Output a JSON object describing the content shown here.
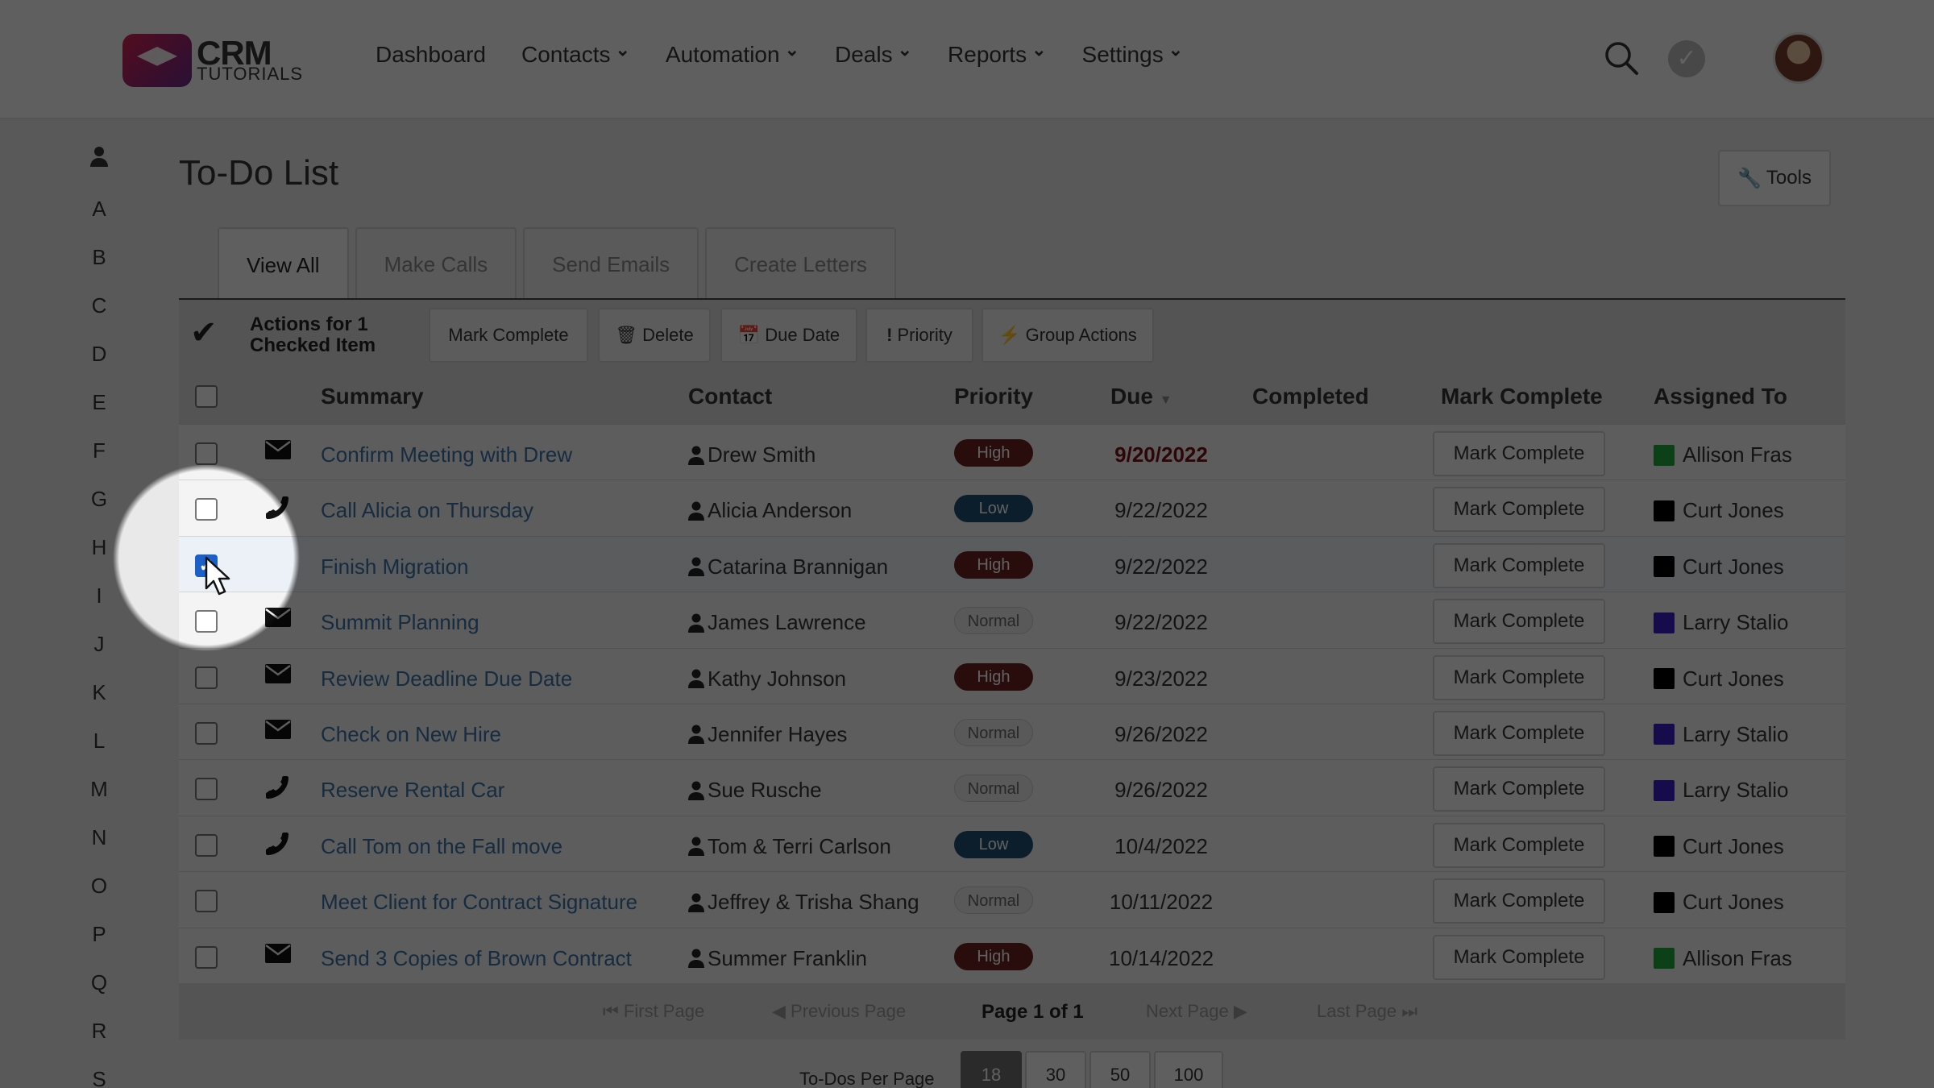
{
  "logo": {
    "line1": "CRM",
    "line2": "TUTORIALS"
  },
  "nav": [
    {
      "label": "Dashboard",
      "dropdown": false
    },
    {
      "label": "Contacts",
      "dropdown": true
    },
    {
      "label": "Automation",
      "dropdown": true
    },
    {
      "label": "Deals",
      "dropdown": true
    },
    {
      "label": "Reports",
      "dropdown": true
    },
    {
      "label": "Settings",
      "dropdown": true
    }
  ],
  "alpha": [
    "A",
    "B",
    "C",
    "D",
    "E",
    "F",
    "G",
    "H",
    "I",
    "J",
    "K",
    "L",
    "M",
    "N",
    "O",
    "P",
    "Q",
    "R",
    "S"
  ],
  "page": {
    "title": "To-Do List",
    "tools_label": "Tools"
  },
  "tabs": [
    "View All",
    "Make Calls",
    "Send Emails",
    "Create Letters"
  ],
  "actions": {
    "label_line1": "Actions for 1",
    "label_line2": "Checked Item",
    "buttons": [
      "Mark Complete",
      "Delete",
      "Due Date",
      "Priority",
      "Group Actions"
    ]
  },
  "columns": {
    "summary": "Summary",
    "contact": "Contact",
    "priority": "Priority",
    "due": "Due",
    "completed": "Completed",
    "mark_complete": "Mark Complete",
    "assigned": "Assigned To"
  },
  "rows": [
    {
      "checked": false,
      "type": "email",
      "summary": "Confirm Meeting with Drew",
      "contact": "Drew Smith",
      "priority": "High",
      "due": "9/20/2022",
      "overdue": true,
      "action": "Mark Complete",
      "assigned": "Allison Fras",
      "color": "#1ea83a"
    },
    {
      "checked": false,
      "type": "phone",
      "summary": "Call Alicia on Thursday",
      "contact": "Alicia Anderson",
      "priority": "Low",
      "due": "9/22/2022",
      "overdue": false,
      "action": "Mark Complete",
      "assigned": "Curt Jones",
      "color": "#000000"
    },
    {
      "checked": true,
      "type": "none",
      "summary": "Finish Migration",
      "contact": "Catarina Brannigan",
      "priority": "High",
      "due": "9/22/2022",
      "overdue": false,
      "action": "Mark Complete",
      "assigned": "Curt Jones",
      "color": "#000000"
    },
    {
      "checked": false,
      "type": "email",
      "summary": "Summit Planning",
      "contact": "James Lawrence",
      "priority": "Normal",
      "due": "9/22/2022",
      "overdue": false,
      "action": "Mark Complete",
      "assigned": "Larry Stalio",
      "color": "#3a1fc4"
    },
    {
      "checked": false,
      "type": "email",
      "summary": "Review Deadline Due Date",
      "contact": "Kathy Johnson",
      "priority": "High",
      "due": "9/23/2022",
      "overdue": false,
      "action": "Mark Complete",
      "assigned": "Curt Jones",
      "color": "#000000"
    },
    {
      "checked": false,
      "type": "email",
      "summary": "Check on New Hire",
      "contact": "Jennifer Hayes",
      "priority": "Normal",
      "due": "9/26/2022",
      "overdue": false,
      "action": "Mark Complete",
      "assigned": "Larry Stalio",
      "color": "#3a1fc4"
    },
    {
      "checked": false,
      "type": "phone",
      "summary": "Reserve Rental Car",
      "contact": "Sue Rusche",
      "priority": "Normal",
      "due": "9/26/2022",
      "overdue": false,
      "action": "Mark Complete",
      "assigned": "Larry Stalio",
      "color": "#3a1fc4"
    },
    {
      "checked": false,
      "type": "phone",
      "summary": "Call Tom on the Fall move",
      "contact": "Tom & Terri Carlson",
      "priority": "Low",
      "due": "10/4/2022",
      "overdue": false,
      "action": "Mark Complete",
      "assigned": "Curt Jones",
      "color": "#000000"
    },
    {
      "checked": false,
      "type": "none",
      "summary": "Meet Client for Contract Signature",
      "contact": "Jeffrey & Trisha Shang",
      "priority": "Normal",
      "due": "10/11/2022",
      "overdue": false,
      "action": "Mark Complete",
      "assigned": "Curt Jones",
      "color": "#000000"
    },
    {
      "checked": false,
      "type": "email",
      "summary": "Send 3 Copies of Brown Contract",
      "contact": "Summer Franklin",
      "priority": "High",
      "due": "10/14/2022",
      "overdue": false,
      "action": "Mark Complete",
      "assigned": "Allison Fras",
      "color": "#1ea83a"
    }
  ],
  "pager": {
    "first": "First Page",
    "prev": "Previous Page",
    "current": "Page 1 of 1",
    "next": "Next Page",
    "last": "Last Page"
  },
  "per_page": {
    "label": "To-Dos Per Page",
    "options": [
      "18",
      "30",
      "50",
      "100"
    ],
    "selected": "18"
  },
  "colors": {
    "link": "#3a72a8",
    "high": "#6b2020",
    "low": "#1e4e74",
    "overdue": "#7a0f16"
  }
}
